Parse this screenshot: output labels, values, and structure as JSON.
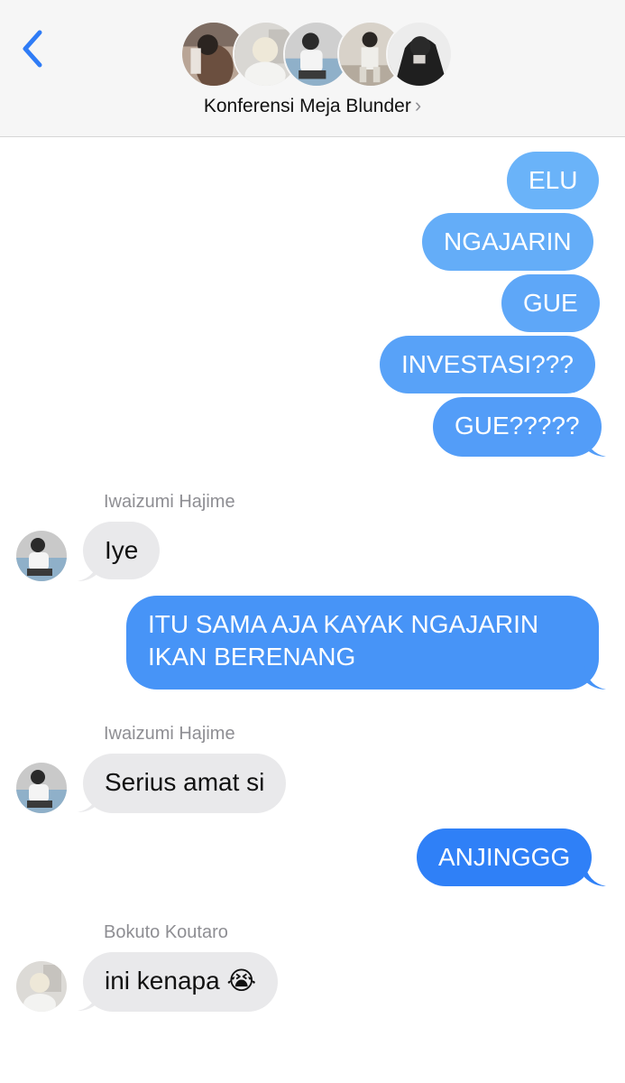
{
  "header": {
    "group_name": "Konferensi Meja Blunder",
    "chevron": "›",
    "back_icon": "chevron-left-icon",
    "back_color": "#2f7cf6"
  },
  "colors": {
    "outgoing_top": "#6ab3f9",
    "outgoing_bottom": "#2d7ef7",
    "incoming": "#e9e9eb"
  },
  "messages": {
    "m1": "ELU",
    "m2": "NGAJARIN",
    "m3": "GUE",
    "m4": "INVESTASI???",
    "m5": "GUE?????",
    "s1": "Iwaizumi Hajime",
    "m6": "Iye",
    "m7": "ITU SAMA AJA KAYAK NGAJARIN IKAN BERENANG",
    "s2": "Iwaizumi Hajime",
    "m8": "Serius amat si",
    "m9": "ANJINGGG",
    "s3": "Bokuto Koutaro",
    "m10": "ini kenapa 😭"
  }
}
